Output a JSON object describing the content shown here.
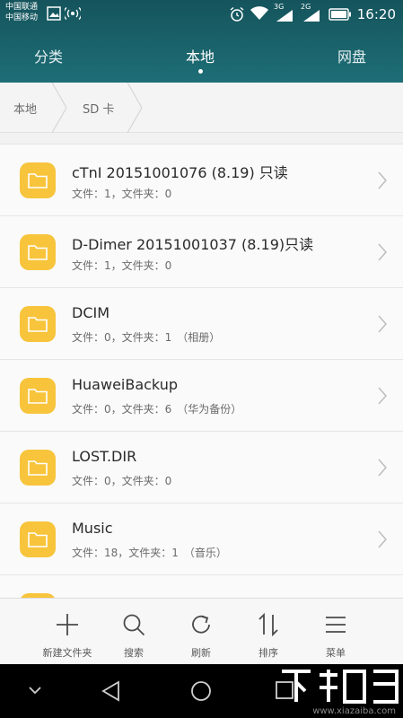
{
  "status_bar": {
    "carrier_1": "中国联通",
    "carrier_2": "中国移动",
    "network_1": "3G",
    "network_2": "2G",
    "time": "16:20"
  },
  "tabs": [
    {
      "label": "分类",
      "active": false
    },
    {
      "label": "本地",
      "active": true
    },
    {
      "label": "网盘",
      "active": false
    }
  ],
  "breadcrumb": [
    "本地",
    "SD 卡"
  ],
  "files": [
    {
      "name": "cTnI 20151001076 (8.19) 只读",
      "meta": "文件：1，文件夹：0"
    },
    {
      "name": "D-Dimer 20151001037 (8.19)只读",
      "meta": "文件：1，文件夹：0"
    },
    {
      "name": "DCIM",
      "meta": "文件：0，文件夹：1　（相册）"
    },
    {
      "name": "HuaweiBackup",
      "meta": "文件：0，文件夹：6　（华为备份）"
    },
    {
      "name": "LOST.DIR",
      "meta": "文件：0，文件夹：0"
    },
    {
      "name": "Music",
      "meta": "文件：18，文件夹：1　（音乐）"
    }
  ],
  "toolbar": {
    "new_folder": "新建文件夹",
    "search": "搜索",
    "refresh": "刷新",
    "sort": "排序",
    "menu": "菜单"
  },
  "watermark": "www.xiazaiba.com",
  "colors": {
    "header": "#1a636b",
    "folder": "#f7c43b",
    "navbar": "#000000"
  }
}
